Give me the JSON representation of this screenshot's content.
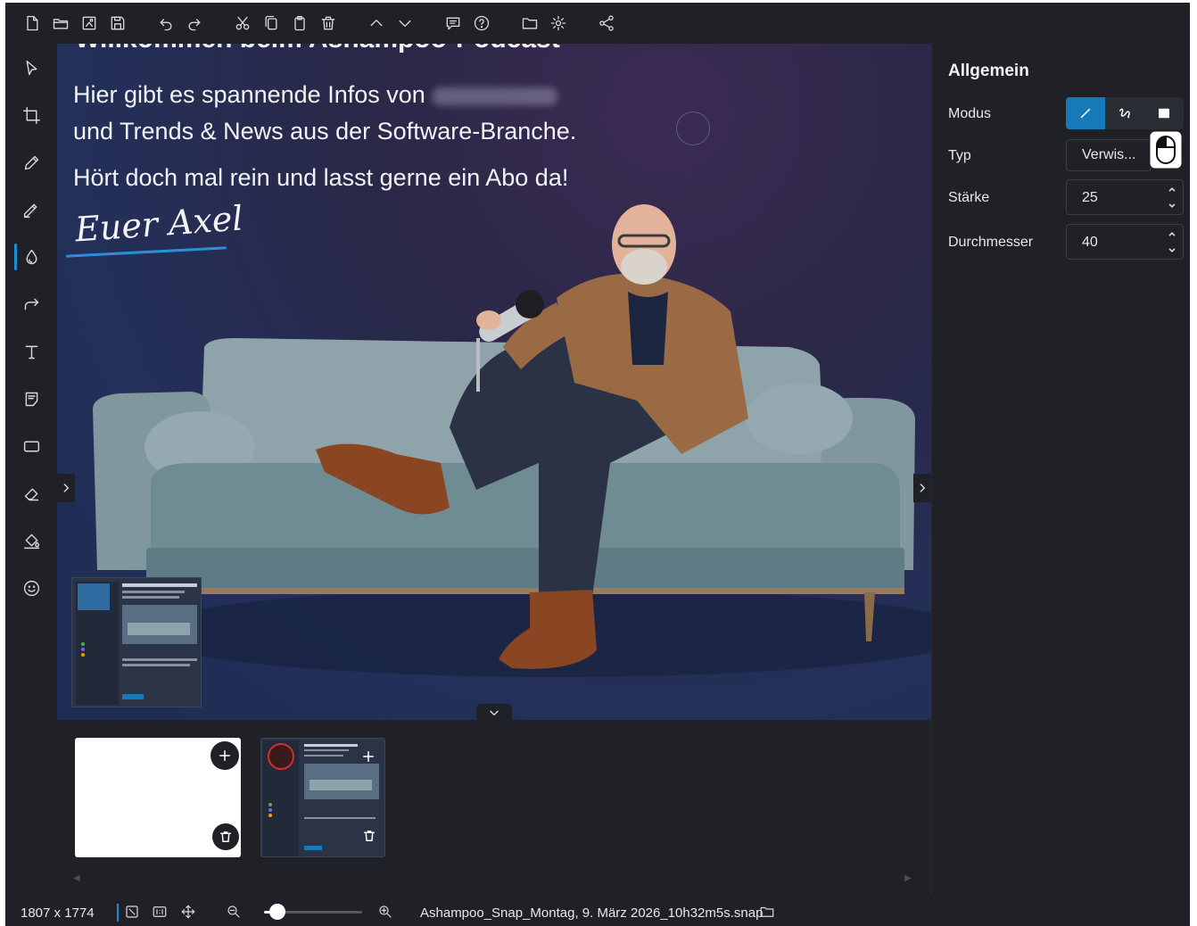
{
  "toolbar": {
    "icons": [
      "new-file-icon",
      "open-folder-icon",
      "save-as-icon",
      "save-icon",
      "undo-icon",
      "redo-icon",
      "cut-icon",
      "copy-icon",
      "paste-icon",
      "delete-icon",
      "move-up-icon",
      "move-down-icon",
      "comment-icon",
      "help-icon",
      "folder-icon",
      "settings-icon",
      "share-icon"
    ]
  },
  "left_tools": {
    "icons": [
      "select-arrow-icon",
      "crop-icon",
      "pencil-icon",
      "marker-icon",
      "blur-drop-icon",
      "arrow-icon",
      "text-icon",
      "note-icon",
      "rectangle-icon",
      "eraser-icon",
      "fill-bucket-icon",
      "emoji-icon"
    ],
    "active": "blur-drop-icon"
  },
  "canvas": {
    "title_top": "Willkommen beim Ashampoo-Podcast",
    "line1": "Hier gibt es spannende Infos von",
    "line2": "und Trends & News aus der Software-Branche.",
    "line3": "Hört doch mal rein und lasst gerne ein Abo da!",
    "signature": "Euer Axel"
  },
  "filmstrip": {
    "items": [
      "blank-snapshot",
      "podcast-snapshot"
    ]
  },
  "panel": {
    "title": "Allgemein",
    "modus_label": "Modus",
    "typ_label": "Typ",
    "typ_value": "Verwis...",
    "staerke_label": "Stärke",
    "staerke_value": "25",
    "durchmesser_label": "Durchmesser",
    "durchmesser_value": "40",
    "accent": "#1679b8"
  },
  "statusbar": {
    "dimensions": "1807 x 1774",
    "zoom_fraction": 0.14,
    "filename": "Ashampoo_Snap_Montag, 9. März 2026_10h32m5s.snap"
  }
}
